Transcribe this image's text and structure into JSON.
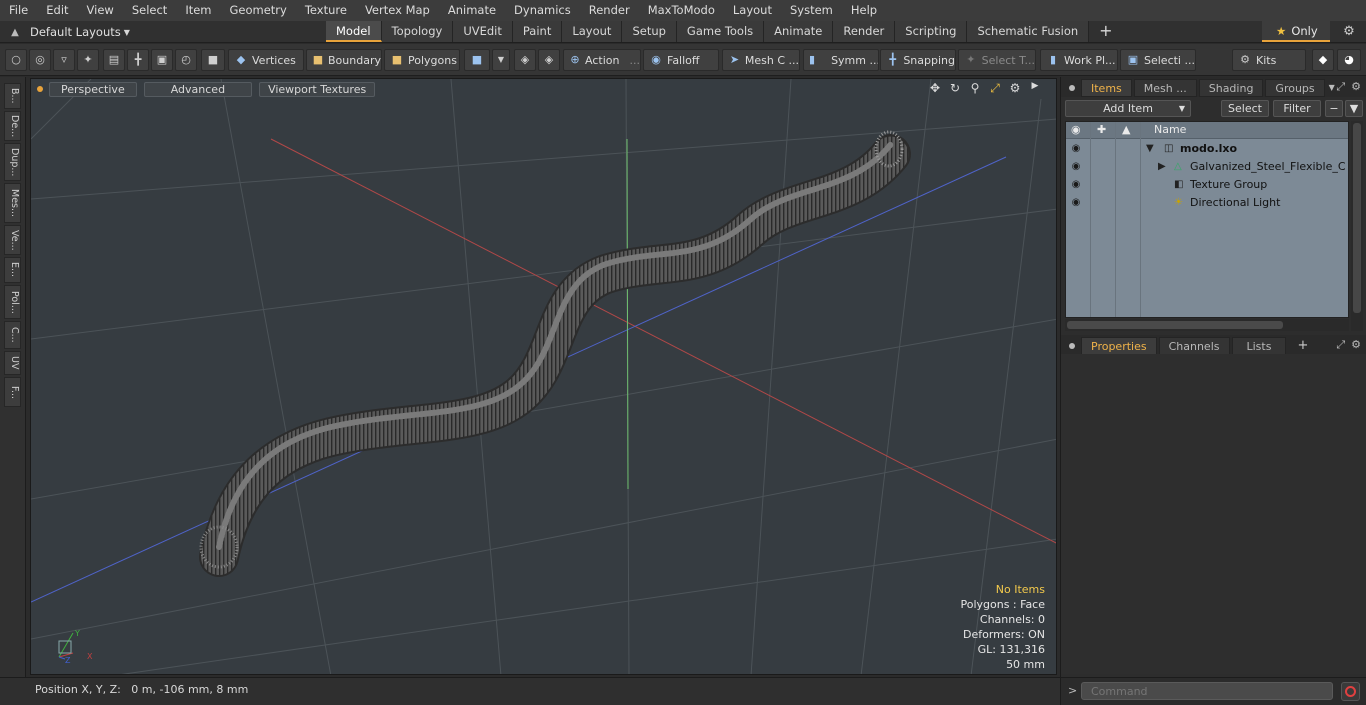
{
  "menu": [
    "File",
    "Edit",
    "View",
    "Select",
    "Item",
    "Geometry",
    "Texture",
    "Vertex Map",
    "Animate",
    "Dynamics",
    "Render",
    "MaxToModo",
    "Layout",
    "System",
    "Help"
  ],
  "layout_selector": "Default Layouts",
  "tabs": [
    "Model",
    "Topology",
    "UVEdit",
    "Paint",
    "Layout",
    "Setup",
    "Game Tools",
    "Animate",
    "Render",
    "Scripting",
    "Schematic Fusion"
  ],
  "tab_plus": "+",
  "only_label": "Only",
  "toolbar": {
    "vertices": "Vertices",
    "boundary": "Boundary",
    "polygons": "Polygons",
    "action": "Action",
    "falloff": "Falloff",
    "mesh": "Mesh C ...",
    "symm": "Symm ...",
    "snapping": "Snapping",
    "select_t": "Select T...",
    "work_pl": "Work Pl...",
    "selecti": "Selecti ...",
    "kits": "Kits"
  },
  "left_strip": [
    "B...",
    "De...",
    "Dup...",
    "Mes...",
    "Ve...",
    "E...",
    "Pol...",
    "C...",
    "UV",
    "F..."
  ],
  "viewport": {
    "buttons": [
      "Perspective",
      "Advanced",
      "Viewport Textures"
    ],
    "info": {
      "no_items": "No Items",
      "polygons": "Polygons : Face",
      "channels": "Channels: 0",
      "deformers": "Deformers: ON",
      "gl": "GL: 131,316",
      "scale": "50 mm"
    }
  },
  "status": "Position X, Y, Z:   0 m, -106 mm, 8 mm",
  "items_panel": {
    "tabs": [
      "Items",
      "Mesh ...",
      "Shading",
      "Groups"
    ],
    "add_item": "Add Item",
    "select": "Select",
    "filter": "Filter",
    "column_name": "Name",
    "rows": [
      {
        "label": "modo.lxo"
      },
      {
        "label": "Galvanized_Steel_Flexible_C ..."
      },
      {
        "label": "Texture Group"
      },
      {
        "label": "Directional Light"
      }
    ]
  },
  "props_panel": {
    "tabs": [
      "Properties",
      "Channels",
      "Lists"
    ],
    "plus": "+"
  },
  "command_placeholder": "Command",
  "colors": {
    "accent": "#e8a33b",
    "viewport_bg": "#363c41",
    "tree_bg": "#7d8a96"
  }
}
